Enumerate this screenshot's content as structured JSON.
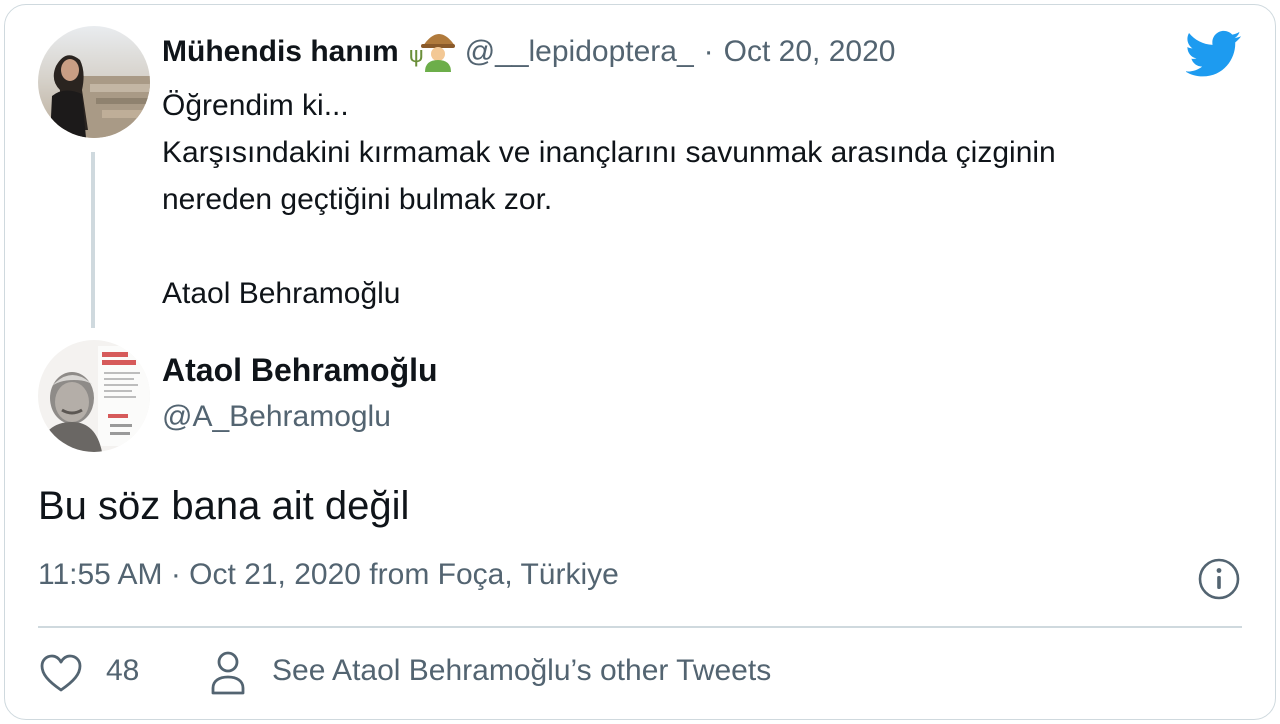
{
  "parent_tweet": {
    "author_name": "Mühendis hanım",
    "author_emoji": "farmer-emoji",
    "handle": "@__lepidoptera_",
    "separator": "·",
    "date": "Oct 20, 2020",
    "lines": [
      "Öğrendim ki...",
      "Karşısındakini kırmamak ve inançlarını savunmak arasında çizginin",
      "nereden geçtiğini bulmak zor.",
      "",
      "Ataol Behramoğlu"
    ]
  },
  "reply_tweet": {
    "author_name": "Ataol Behramoğlu",
    "handle": "@A_Behramoglu",
    "text": "Bu söz bana ait değil",
    "meta": "11:55 AM · Oct 21, 2020 from Foça, Türkiye"
  },
  "footer": {
    "like_count": "48",
    "see_more": "See Ataol Behramoğlu’s other Tweets"
  },
  "colors": {
    "brand": "#1d9bf0",
    "muted": "#536471",
    "border": "#cfd9de",
    "text": "#0f1419"
  },
  "icons": [
    "twitter-bird-icon",
    "info-icon",
    "heart-icon",
    "user-icon"
  ]
}
